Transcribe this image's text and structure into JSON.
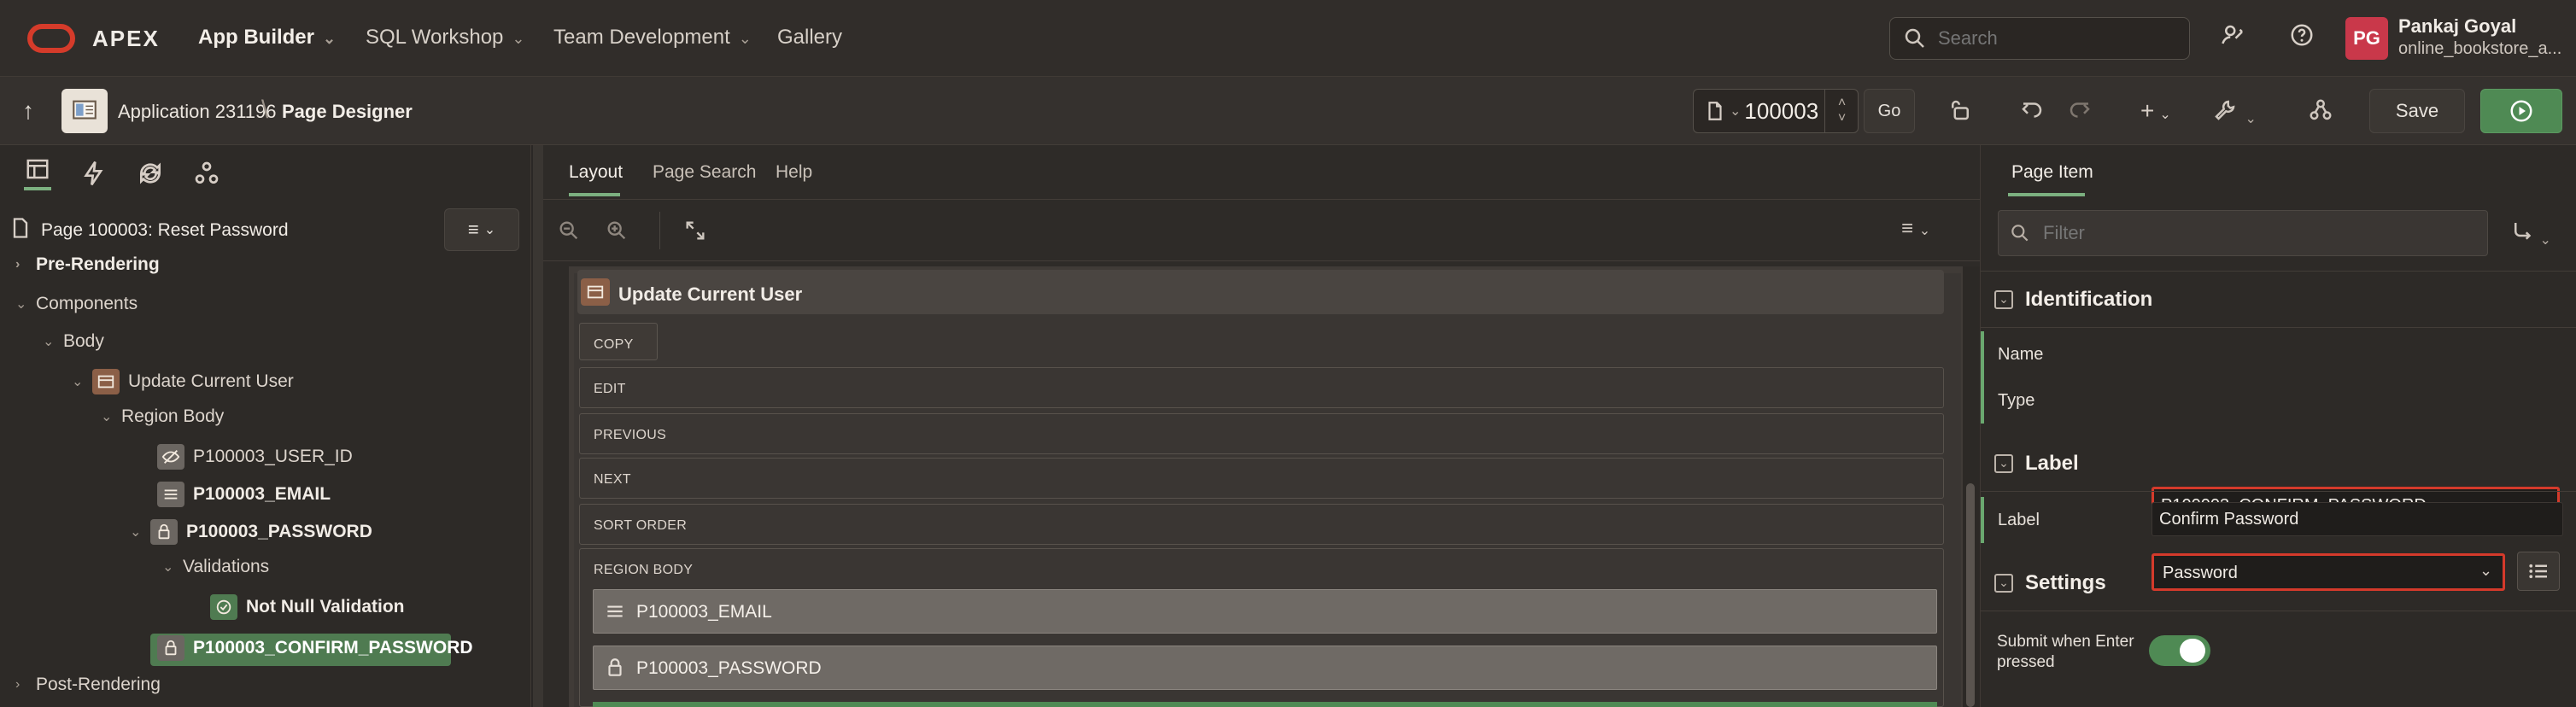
{
  "topbar": {
    "brand": "APEX",
    "nav": [
      {
        "label": "App Builder",
        "has_menu": true
      },
      {
        "label": "SQL Workshop",
        "has_menu": true
      },
      {
        "label": "Team Development",
        "has_menu": true
      },
      {
        "label": "Gallery",
        "has_menu": false
      }
    ],
    "search_placeholder": "Search",
    "user": {
      "initials": "PG",
      "name": "Pankaj Goyal",
      "workspace": "online_bookstore_a..."
    }
  },
  "toolbar": {
    "app_crumb": "Application 231196",
    "page_crumb": "Page Designer",
    "page_number": "100003",
    "go_label": "Go",
    "save_label": "Save"
  },
  "left": {
    "page_title": "Page 100003: Reset Password",
    "tree": {
      "pre_rendering": "Pre-Rendering",
      "components": "Components",
      "body": "Body",
      "region": "Update Current User",
      "region_body": "Region Body",
      "item_user_id": "P100003_USER_ID",
      "item_email": "P100003_EMAIL",
      "item_password": "P100003_PASSWORD",
      "validations": "Validations",
      "validation_name": "Not Null Validation",
      "item_confirm": "P100003_CONFIRM_PASSWORD",
      "post_rendering": "Post-Rendering"
    }
  },
  "center": {
    "tabs": [
      "Layout",
      "Page Search",
      "Help"
    ],
    "region_title": "Update Current User",
    "slots": [
      "COPY",
      "EDIT",
      "PREVIOUS",
      "NEXT",
      "SORT ORDER",
      "REGION BODY"
    ],
    "items": [
      "P100003_EMAIL",
      "P100003_PASSWORD"
    ]
  },
  "right": {
    "tab": "Page Item",
    "filter_placeholder": "Filter",
    "sections": {
      "identification": "Identification",
      "label": "Label",
      "settings": "Settings"
    },
    "fields": {
      "name_label": "Name",
      "name_value": "P100003_CONFIRM_PASSWORD",
      "type_label": "Type",
      "type_value": "Password",
      "label_label": "Label",
      "label_value": "Confirm Password",
      "submit_label": "Submit when Enter pressed"
    }
  }
}
